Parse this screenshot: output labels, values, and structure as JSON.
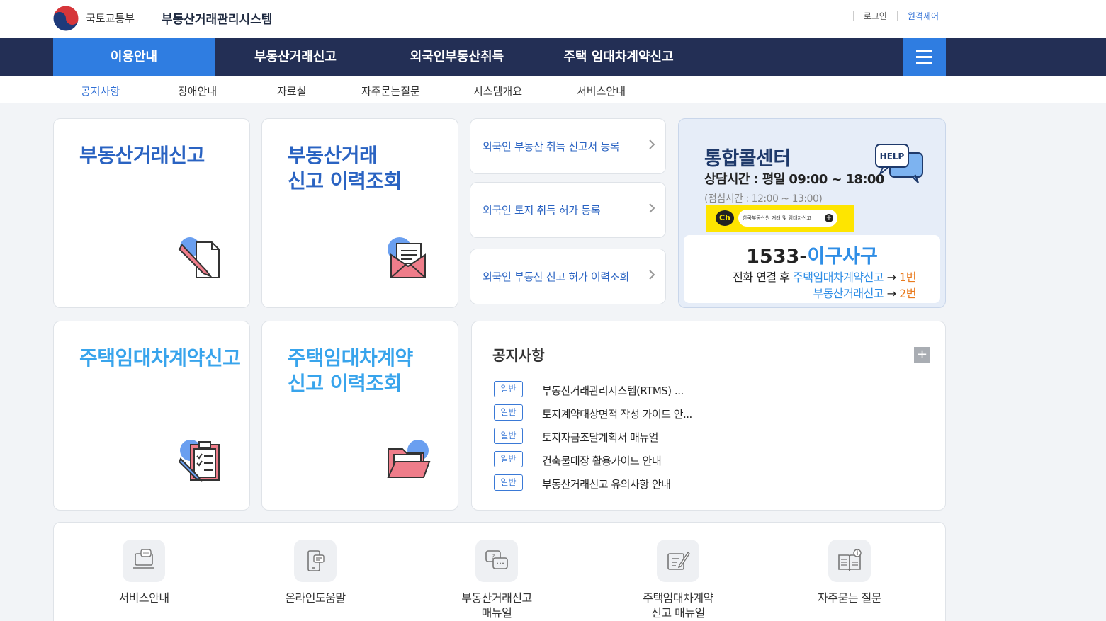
{
  "header": {
    "org_name": "국토교통부",
    "system_name": "부동산거래관리시스템",
    "login_label": "로그인",
    "remote_label": "원격제어"
  },
  "gnb": {
    "items": [
      {
        "label": "이용안내",
        "active": true
      },
      {
        "label": "부동산거래신고"
      },
      {
        "label": "외국인부동산취득"
      },
      {
        "label": "주택 임대차계약신고"
      }
    ]
  },
  "lnb": {
    "items": [
      "공지사항",
      "장애안내",
      "자료실",
      "자주묻는질문",
      "시스템개요",
      "서비스안내"
    ]
  },
  "cards": {
    "real_estate_report": "부동산거래신고",
    "real_estate_history": "부동산거래\n신고 이력조회",
    "lease_report": "주택임대차계약신고",
    "lease_history": "주택임대차계약\n신고 이력조회"
  },
  "foreign_links": [
    "외국인 부동산 취득 신고서 등록",
    "외국인 토지 취득 허가 등록",
    "외국인 부동산 신고 허가 이력조회"
  ],
  "call_center": {
    "title": "통합콜센터",
    "hours": "상담시간 : 평일 09:00 ~ 18:00",
    "lunch": "(점심시간 : 12:00 ~ 13:00)",
    "help_icon_text": "HELP",
    "kakao_ch": "Ch",
    "kakao_text": "한국부동산원 거래 및 임대차신고",
    "phone_prefix": "1533-",
    "phone_suffix": "이구사구",
    "route_prefix": "전화 연결 후 ",
    "route1_service": "주택임대차계약신고",
    "route1_arrow": " → ",
    "route1_num": "1번",
    "route2_service": "부동산거래신고",
    "route2_arrow": " → ",
    "route2_num": "2번"
  },
  "notice": {
    "title": "공지사항",
    "more": "+",
    "items": [
      {
        "badge": "일반",
        "text": "부동산거래관리시스템(RTMS) ..."
      },
      {
        "badge": "일반",
        "text": "토지계약대상면적 작성 가이드 안..."
      },
      {
        "badge": "일반",
        "text": "토지자금조달계획서 매뉴얼"
      },
      {
        "badge": "일반",
        "text": "건축물대장 활용가이드 안내"
      },
      {
        "badge": "일반",
        "text": "부동산거래신고 유의사항 안내"
      }
    ]
  },
  "quick": [
    {
      "label": "서비스안내",
      "icon": "laptop-chat-icon"
    },
    {
      "label": "온라인도움말",
      "icon": "mobile-help-icon"
    },
    {
      "label": "부동산거래신고\n매뉴얼",
      "icon": "question-chat-icon"
    },
    {
      "label": "주택임대차계약\n신고 매뉴얼",
      "icon": "edit-document-icon"
    },
    {
      "label": "자주묻는 질문",
      "icon": "book-info-icon"
    }
  ],
  "colors": {
    "navy": "#232f55",
    "accent_blue": "#2f7de1",
    "title_blue": "#2a63c2",
    "light_blue": "#38a4ec",
    "orange": "#e97b1f",
    "kakao_yellow": "#fee500"
  }
}
